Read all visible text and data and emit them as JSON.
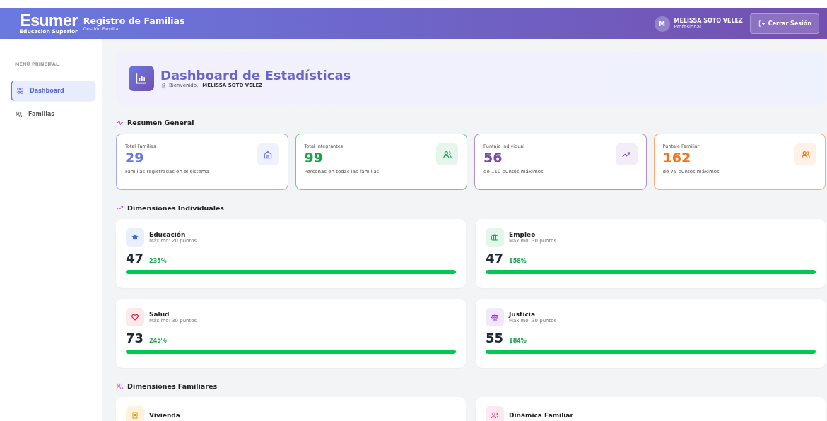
{
  "header": {
    "logo": "Esumer",
    "logo_tagline": "Educación Superior",
    "title": "Registro de Familias",
    "subtitle": "Gestión Familiar",
    "user": {
      "initial": "M",
      "name": "MELISSA SOTO VELEZ",
      "role": "Profesional"
    },
    "logout": "Cerrar Sesión"
  },
  "sidebar": {
    "heading": "MENÚ PRINCIPAL",
    "items": [
      {
        "label": "Dashboard",
        "selected": true
      },
      {
        "label": "Familias",
        "selected": false
      }
    ]
  },
  "hero": {
    "title": "Dashboard de Estadísticas",
    "greeting": "Bienvenido,",
    "user": "MELISSA SOTO VELEZ"
  },
  "summary": {
    "title": "Resumen General",
    "stats": [
      {
        "label": "Total Familias",
        "value": "29",
        "note": "Familias registradas en el sistema",
        "color": "#6577e6"
      },
      {
        "label": "Total Integrantes",
        "value": "99",
        "note": "Personas en todas las familias",
        "color": "#16a34a"
      },
      {
        "label": "Puntaje Individual",
        "value": "56",
        "note": "de 110 puntos máximos",
        "color": "#7b4aa8"
      },
      {
        "label": "Puntaje Familiar",
        "value": "162",
        "note": "de 75 puntos máximos",
        "color": "#f97316"
      }
    ]
  },
  "individual": {
    "title": "Dimensiones Individuales",
    "items": [
      {
        "kind": "education",
        "name": "Educación",
        "max": "Máximo: 20 puntos",
        "score": "47",
        "percent": "235%",
        "level": 1
      },
      {
        "kind": "employment",
        "name": "Empleo",
        "max": "Máximo: 30 puntos",
        "score": "47",
        "percent": "158%",
        "level": 1
      },
      {
        "kind": "health",
        "name": "Salud",
        "max": "Máximo: 30 puntos",
        "score": "73",
        "percent": "245%",
        "level": 1
      },
      {
        "kind": "justice",
        "name": "Justicia",
        "max": "Máximo: 30 puntos",
        "score": "55",
        "percent": "184%",
        "level": 1
      }
    ]
  },
  "familiar": {
    "title": "Dimensiones Familiares",
    "items": [
      {
        "kind": "housing",
        "name": "Vivienda"
      },
      {
        "kind": "family",
        "name": "Dinámica Familiar"
      }
    ]
  }
}
